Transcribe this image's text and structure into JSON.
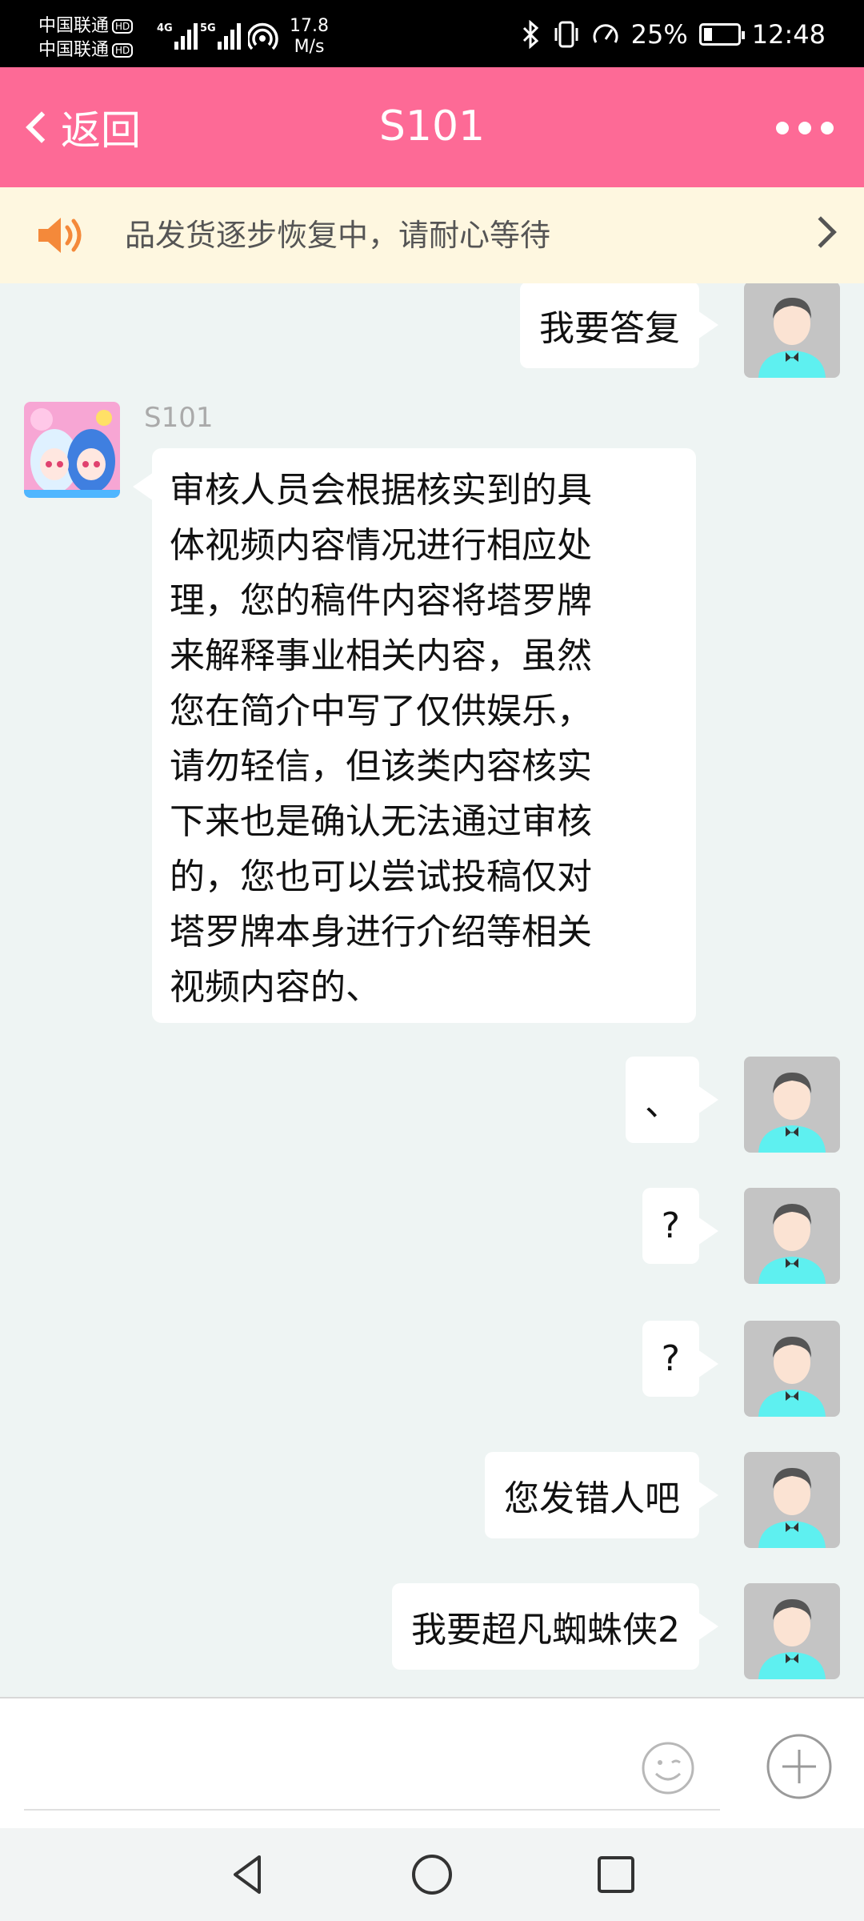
{
  "status_bar": {
    "carrier_1": "中国联通",
    "carrier_2": "中国联通",
    "hd_badge": "HD",
    "sim1_network": "4G",
    "sim2_network": "5G",
    "net_speed_value": "17.8",
    "net_speed_unit": "M/s",
    "battery": "25%",
    "time": "12:48"
  },
  "header": {
    "back_label": "返回",
    "title": "S101",
    "color": "#fd6a96"
  },
  "notice": {
    "text": "品发货逐步恢复中，请耐心等待"
  },
  "messages": [
    {
      "side": "right",
      "text": "我要答复"
    },
    {
      "side": "left",
      "sender": "S101",
      "lines": [
        "审核人员会根据核实到的具",
        "体视频内容情况进行相应处",
        "理，您的稿件内容将塔罗牌",
        "来解释事业相关内容，虽然",
        "您在简介中写了仅供娱乐，",
        "请勿轻信，但该类内容核实",
        "下来也是确认无法通过审核",
        "的，您也可以尝试投稿仅对",
        "塔罗牌本身进行介绍等相关",
        "视频内容的、"
      ]
    },
    {
      "side": "right",
      "text": "、"
    },
    {
      "side": "right",
      "text": "?"
    },
    {
      "side": "right",
      "text": "?"
    },
    {
      "side": "right",
      "text": "您发错人吧"
    },
    {
      "side": "right",
      "text": "我要超凡蜘蛛侠2"
    }
  ],
  "input": {
    "placeholder": ""
  },
  "icons": {
    "back": "chevron-left-icon",
    "more": "more-dots-icon",
    "speaker": "speaker-icon",
    "notice_arrow": "chevron-right-icon",
    "emoji": "emoji-icon",
    "plus": "plus-icon",
    "nav_back": "nav-back-icon",
    "nav_home": "nav-home-icon",
    "nav_recents": "nav-recents-icon"
  }
}
